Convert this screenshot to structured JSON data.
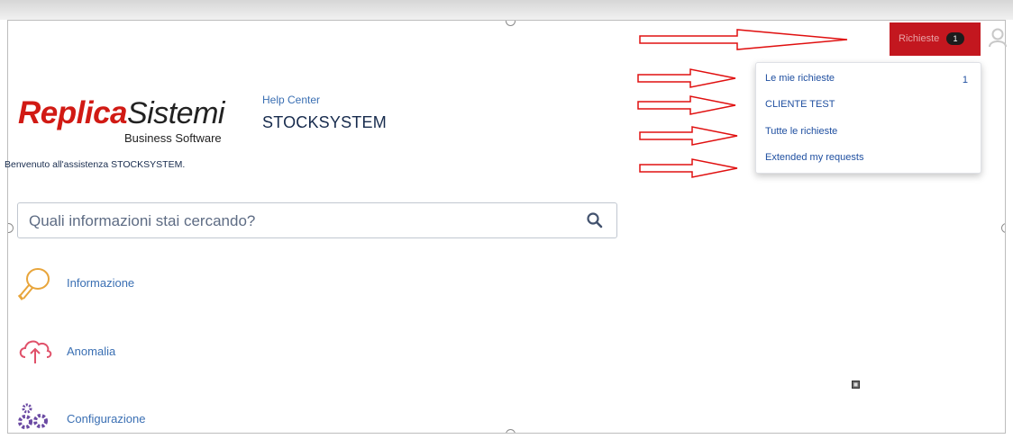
{
  "brand": {
    "logo_bold": "Replica",
    "logo_thin": "Sistemi",
    "logo_sub": "Business Software",
    "logo_color": "#d11a14"
  },
  "header": {
    "help_center": "Help Center",
    "portal_name": "STOCKSYSTEM",
    "welcome": "Benvenuto all'assistenza STOCKSYSTEM."
  },
  "search": {
    "placeholder": "Quali informazioni stai cercando?",
    "icon": "search-icon"
  },
  "request_types": [
    {
      "label": "Informazione",
      "icon": "lightbulb-icon"
    },
    {
      "label": "Anomalia",
      "icon": "cloud-upload-icon"
    },
    {
      "label": "Configurazione",
      "icon": "gears-icon"
    }
  ],
  "top_nav": {
    "requests_label": "Richieste",
    "requests_count": "1",
    "requests_color": "#c3171f",
    "avatar_icon": "user-avatar-icon"
  },
  "dropdown": {
    "items": [
      {
        "label": "Le mie richieste",
        "count": "1"
      },
      {
        "label": "CLIENTE TEST"
      },
      {
        "label": "Tutte le richieste"
      },
      {
        "label": "Extended my requests"
      }
    ]
  },
  "annotations": {
    "arrow_color": "#e01010"
  }
}
